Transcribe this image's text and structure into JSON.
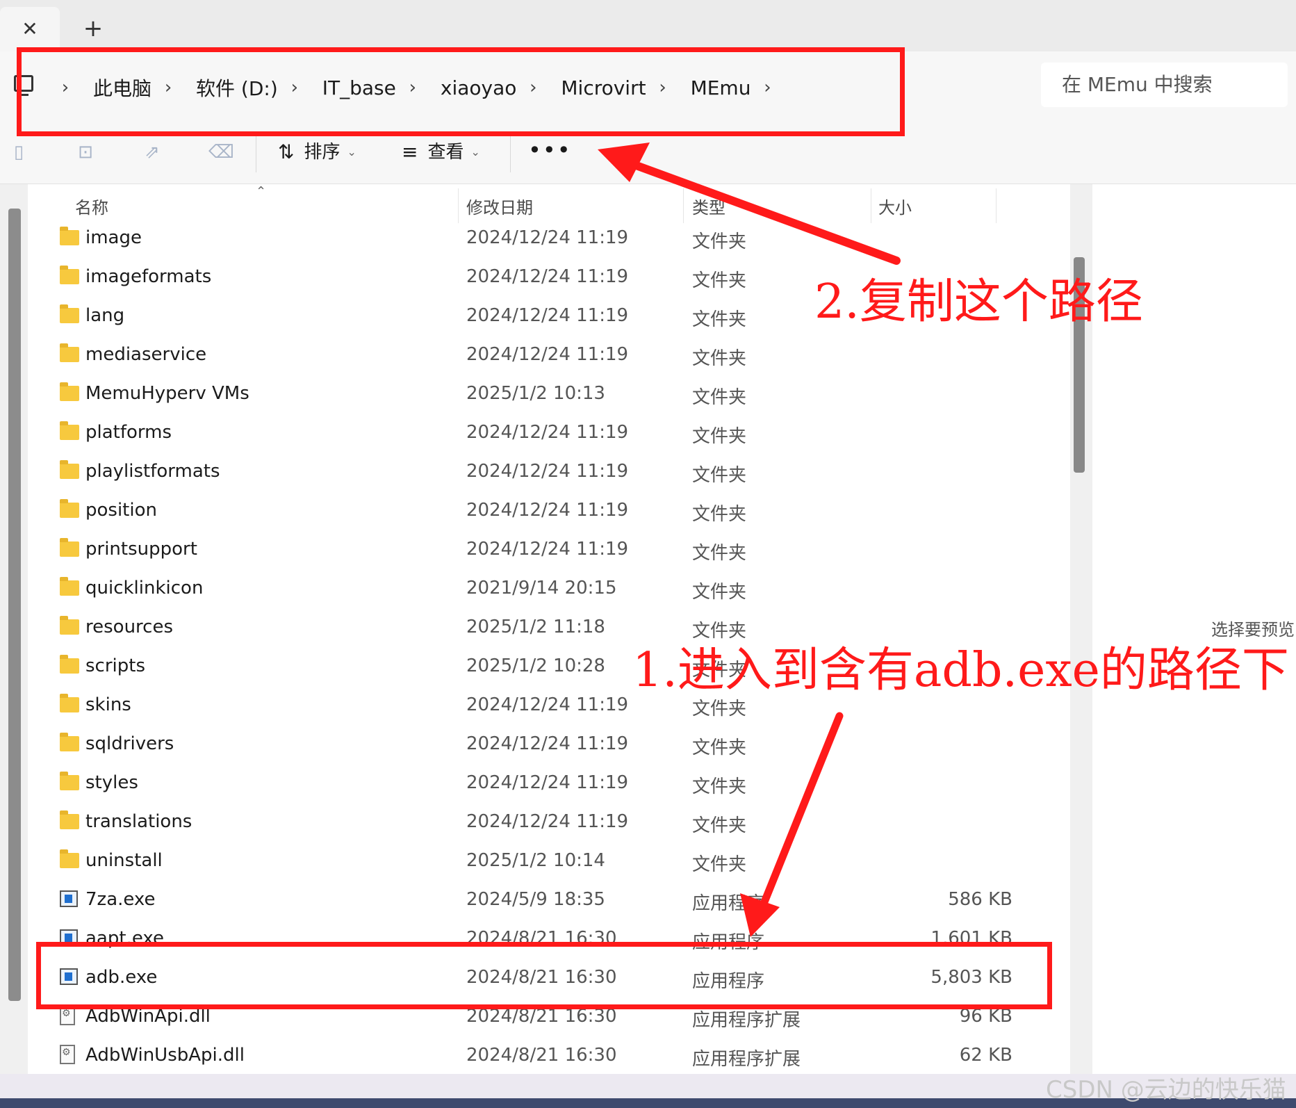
{
  "tabs": {
    "close_glyph": "✕",
    "new_glyph": "+"
  },
  "address_bar": {
    "crumbs": [
      "此电脑",
      "软件 (D:)",
      "IT_base",
      "xiaoyao",
      "Microvirt",
      "MEmu"
    ],
    "separator": "›"
  },
  "search": {
    "placeholder": "在 MEmu 中搜索"
  },
  "toolbar": {
    "sort_label": "排序",
    "view_label": "查看",
    "more_label": "•••",
    "icons": [
      "paste-icon",
      "rename-icon",
      "share-icon",
      "delete-icon",
      "sort-icon",
      "view-icon"
    ]
  },
  "columns": {
    "name": "名称",
    "modified": "修改日期",
    "type": "类型",
    "size": "大小"
  },
  "files": [
    {
      "name": "image",
      "date": "2024/12/24 11:19",
      "type": "文件夹",
      "size": "",
      "kind": "folder"
    },
    {
      "name": "imageformats",
      "date": "2024/12/24 11:19",
      "type": "文件夹",
      "size": "",
      "kind": "folder"
    },
    {
      "name": "lang",
      "date": "2024/12/24 11:19",
      "type": "文件夹",
      "size": "",
      "kind": "folder"
    },
    {
      "name": "mediaservice",
      "date": "2024/12/24 11:19",
      "type": "文件夹",
      "size": "",
      "kind": "folder"
    },
    {
      "name": "MemuHyperv VMs",
      "date": "2025/1/2 10:13",
      "type": "文件夹",
      "size": "",
      "kind": "folder"
    },
    {
      "name": "platforms",
      "date": "2024/12/24 11:19",
      "type": "文件夹",
      "size": "",
      "kind": "folder"
    },
    {
      "name": "playlistformats",
      "date": "2024/12/24 11:19",
      "type": "文件夹",
      "size": "",
      "kind": "folder"
    },
    {
      "name": "position",
      "date": "2024/12/24 11:19",
      "type": "文件夹",
      "size": "",
      "kind": "folder"
    },
    {
      "name": "printsupport",
      "date": "2024/12/24 11:19",
      "type": "文件夹",
      "size": "",
      "kind": "folder"
    },
    {
      "name": "quicklinkicon",
      "date": "2021/9/14 20:15",
      "type": "文件夹",
      "size": "",
      "kind": "folder"
    },
    {
      "name": "resources",
      "date": "2025/1/2 11:18",
      "type": "文件夹",
      "size": "",
      "kind": "folder"
    },
    {
      "name": "scripts",
      "date": "2025/1/2 10:28",
      "type": "文件夹",
      "size": "",
      "kind": "folder"
    },
    {
      "name": "skins",
      "date": "2024/12/24 11:19",
      "type": "文件夹",
      "size": "",
      "kind": "folder"
    },
    {
      "name": "sqldrivers",
      "date": "2024/12/24 11:19",
      "type": "文件夹",
      "size": "",
      "kind": "folder"
    },
    {
      "name": "styles",
      "date": "2024/12/24 11:19",
      "type": "文件夹",
      "size": "",
      "kind": "folder"
    },
    {
      "name": "translations",
      "date": "2024/12/24 11:19",
      "type": "文件夹",
      "size": "",
      "kind": "folder"
    },
    {
      "name": "uninstall",
      "date": "2025/1/2 10:14",
      "type": "文件夹",
      "size": "",
      "kind": "folder"
    },
    {
      "name": "7za.exe",
      "date": "2024/5/9 18:35",
      "type": "应用程序",
      "size": "586 KB",
      "kind": "exe"
    },
    {
      "name": "aapt.exe",
      "date": "2024/8/21 16:30",
      "type": "应用程序",
      "size": "1,601 KB",
      "kind": "exe"
    },
    {
      "name": "adb.exe",
      "date": "2024/8/21 16:30",
      "type": "应用程序",
      "size": "5,803 KB",
      "kind": "exe"
    },
    {
      "name": "AdbWinApi.dll",
      "date": "2024/8/21 16:30",
      "type": "应用程序扩展",
      "size": "96 KB",
      "kind": "dll"
    },
    {
      "name": "AdbWinUsbApi.dll",
      "date": "2024/8/21 16:30",
      "type": "应用程序扩展",
      "size": "62 KB",
      "kind": "dll"
    }
  ],
  "preview_hint": "选择要预览",
  "annotations": {
    "step2": "2.复制这个路径",
    "step1": "1.进入到含有adb.exe的路径下"
  },
  "watermark": "CSDN @云边的快乐猫",
  "colors": {
    "annotation": "#ff1a1a",
    "folder": "#f7c93e",
    "exe_accent": "#1f6fcf"
  }
}
